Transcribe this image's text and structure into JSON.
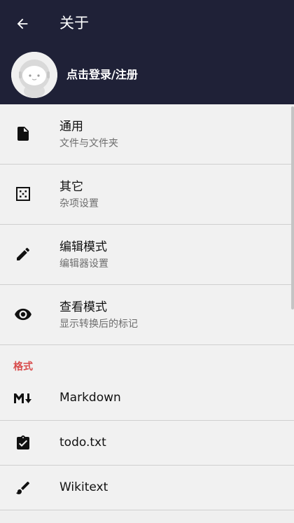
{
  "appbar": {
    "title": "关于",
    "login_label": "点击登录/注册"
  },
  "settings": [
    {
      "title": "通用",
      "subtitle": "文件与文件夹",
      "icon": "file-icon"
    },
    {
      "title": "其它",
      "subtitle": "杂项设置",
      "icon": "dots-grid-icon"
    },
    {
      "title": "编辑模式",
      "subtitle": "编辑器设置",
      "icon": "pencil-icon"
    },
    {
      "title": "查看模式",
      "subtitle": "显示转换后的标记",
      "icon": "eye-icon"
    }
  ],
  "formats": {
    "header": "格式",
    "items": [
      {
        "label": "Markdown",
        "icon": "markdown-icon"
      },
      {
        "label": "todo.txt",
        "icon": "clipboard-check-icon"
      },
      {
        "label": "Wikitext",
        "icon": "brush-icon"
      }
    ]
  },
  "colors": {
    "appbar": "#1f2137",
    "section_header": "#d84c4c",
    "background": "#efefef"
  }
}
